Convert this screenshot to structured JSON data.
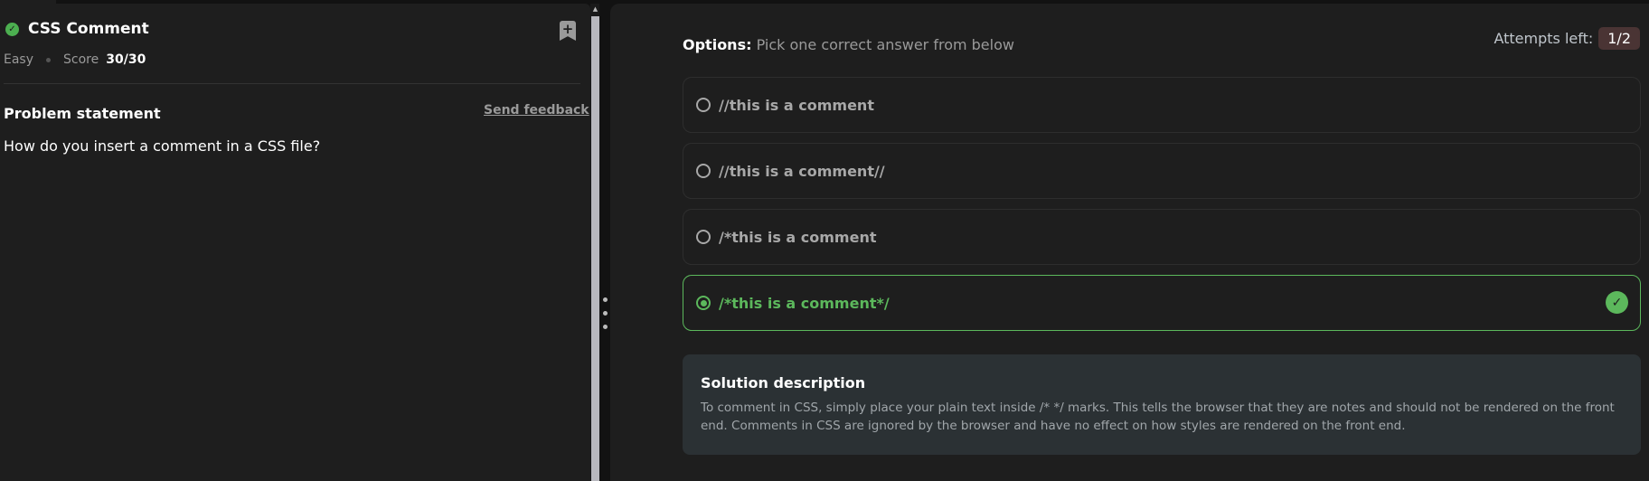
{
  "problem": {
    "title": "CSS Comment",
    "difficulty": "Easy",
    "score_label": "Score",
    "score": "30/30",
    "section_title": "Problem statement",
    "feedback_link": "Send feedback",
    "question": "How do you insert a comment in a CSS file?"
  },
  "options": {
    "heading": "Options:",
    "instruction": "Pick one correct answer from below",
    "attempts_label": "Attempts left:",
    "attempts": "1/2",
    "items": [
      {
        "label": "//this is a comment"
      },
      {
        "label": "//this is a comment//"
      },
      {
        "label": "/*this is a comment"
      },
      {
        "label": "/*this is a comment*/"
      }
    ],
    "selected_index": 3
  },
  "solution": {
    "title": "Solution description",
    "text": "To comment in CSS, simply place your plain text inside /* */ marks. This tells the browser that they are notes and should not be rendered on the front end. Comments in CSS are ignored by the browser and have no effect on how styles are rendered on the front end."
  },
  "colors": {
    "correct": "#5cb85c",
    "badge": "#4a3434"
  }
}
